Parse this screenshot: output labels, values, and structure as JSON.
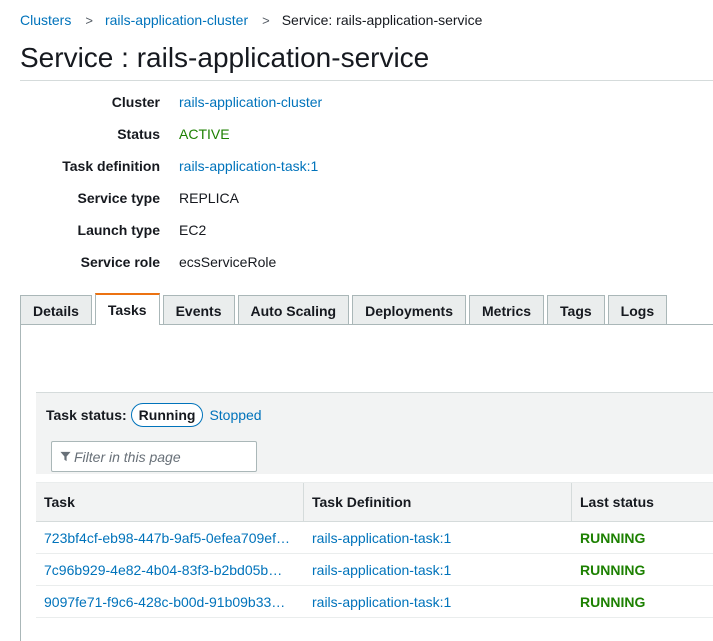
{
  "breadcrumb": {
    "items": [
      "Clusters",
      "rails-application-cluster"
    ],
    "current": "Service: rails-application-service",
    "separator": ">"
  },
  "page_title": "Service : rails-application-service",
  "details": [
    {
      "label": "Cluster",
      "value": "rails-application-cluster",
      "style": "link"
    },
    {
      "label": "Status",
      "value": "ACTIVE",
      "style": "active"
    },
    {
      "label": "Task definition",
      "value": "rails-application-task:1",
      "style": "link"
    },
    {
      "label": "Service type",
      "value": "REPLICA",
      "style": "plain"
    },
    {
      "label": "Launch type",
      "value": "EC2",
      "style": "plain"
    },
    {
      "label": "Service role",
      "value": "ecsServiceRole",
      "style": "plain"
    }
  ],
  "tabs": [
    {
      "label": "Details",
      "active": false
    },
    {
      "label": "Tasks",
      "active": true
    },
    {
      "label": "Events",
      "active": false
    },
    {
      "label": "Auto Scaling",
      "active": false
    },
    {
      "label": "Deployments",
      "active": false
    },
    {
      "label": "Metrics",
      "active": false
    },
    {
      "label": "Tags",
      "active": false
    },
    {
      "label": "Logs",
      "active": false
    }
  ],
  "task_status": {
    "label": "Task status:",
    "running": "Running",
    "stopped": "Stopped"
  },
  "filter": {
    "placeholder": "Filter in this page",
    "icon": "filter-icon"
  },
  "table": {
    "columns": [
      "Task",
      "Task Definition",
      "Last status"
    ],
    "rows": [
      {
        "task": "723bf4cf-eb98-447b-9af5-0efea709ef…",
        "definition": "rails-application-task:1",
        "status": "RUNNING"
      },
      {
        "task": "7c96b929-4e82-4b04-83f3-b2bd05b…",
        "definition": "rails-application-task:1",
        "status": "RUNNING"
      },
      {
        "task": "9097fe71-f9c6-428c-b00d-91b09b33…",
        "definition": "rails-application-task:1",
        "status": "RUNNING"
      }
    ]
  },
  "colors": {
    "link": "#0073bb",
    "active_status": "#1d8102",
    "tab_accent": "#ec7211"
  }
}
